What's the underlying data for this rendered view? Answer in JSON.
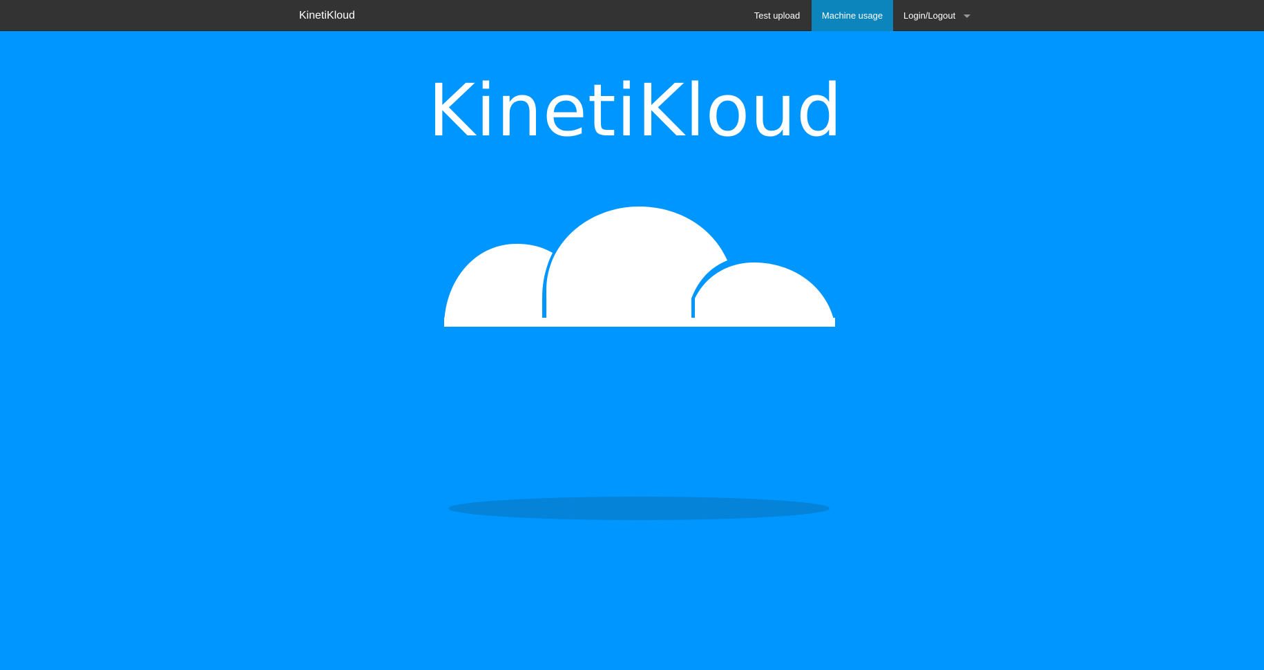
{
  "navbar": {
    "brand": "KinetiKloud",
    "items": [
      {
        "label": "Test upload",
        "active": false
      },
      {
        "label": "Machine usage",
        "active": true
      },
      {
        "label": "Login/Logout",
        "active": false,
        "has_dropdown": true
      }
    ]
  },
  "hero": {
    "title": "KinetiKloud"
  },
  "colors": {
    "background": "#0096ff",
    "navbar": "#333333",
    "active_nav": "#0b85bb",
    "cloud": "#ffffff",
    "cloud_shadow": "#0483d9"
  }
}
